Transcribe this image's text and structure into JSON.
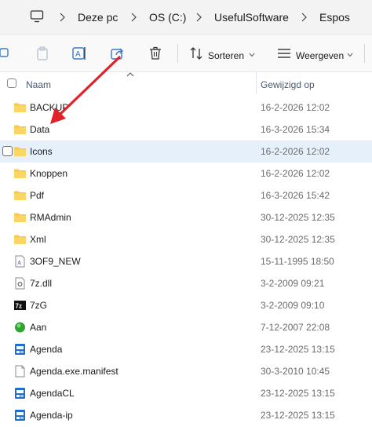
{
  "address": {
    "crumbs": [
      "Deze pc",
      "OS (C:)",
      "UsefulSoftware",
      "Espos"
    ]
  },
  "toolbar": {
    "sort_label": "Sorteren",
    "view_label": "Weergeven"
  },
  "columns": {
    "name": "Naam",
    "modified": "Gewijzigd op"
  },
  "files": [
    {
      "name": "BACKUP",
      "date": "16-2-2026 12:02",
      "icon": "folder-icon"
    },
    {
      "name": "Data",
      "date": "16-3-2026 15:34",
      "icon": "folder-icon"
    },
    {
      "name": "Icons",
      "date": "16-2-2026 12:02",
      "icon": "folder-icon"
    },
    {
      "name": "Knoppen",
      "date": "16-2-2026 12:02",
      "icon": "folder-icon"
    },
    {
      "name": "Pdf",
      "date": "16-3-2026 15:42",
      "icon": "folder-icon"
    },
    {
      "name": "RMAdmin",
      "date": "30-12-2025 12:35",
      "icon": "folder-icon"
    },
    {
      "name": "Xml",
      "date": "30-12-2025 12:35",
      "icon": "folder-icon"
    },
    {
      "name": "3OF9_NEW",
      "date": "15-11-1995 18:50",
      "icon": "font-file-icon"
    },
    {
      "name": "7z.dll",
      "date": "3-2-2009 09:21",
      "icon": "dll-file-icon"
    },
    {
      "name": "7zG",
      "date": "3-2-2009 09:10",
      "icon": "7zip-icon"
    },
    {
      "name": "Aan",
      "date": "7-12-2007 22:08",
      "icon": "green-circle-icon"
    },
    {
      "name": "Agenda",
      "date": "23-12-2025 13:15",
      "icon": "app-exe-icon"
    },
    {
      "name": "Agenda.exe.manifest",
      "date": "30-3-2010 10:45",
      "icon": "file-icon"
    },
    {
      "name": "AgendaCL",
      "date": "23-12-2025 13:15",
      "icon": "app-exe-icon"
    },
    {
      "name": "Agenda-ip",
      "date": "23-12-2025 13:15",
      "icon": "app-exe-icon"
    }
  ],
  "colors": {
    "folder": "#f8c94a",
    "selection": "#e6f0fb",
    "arrow": "#e0222a",
    "app_icon": "#1f6fd1"
  }
}
